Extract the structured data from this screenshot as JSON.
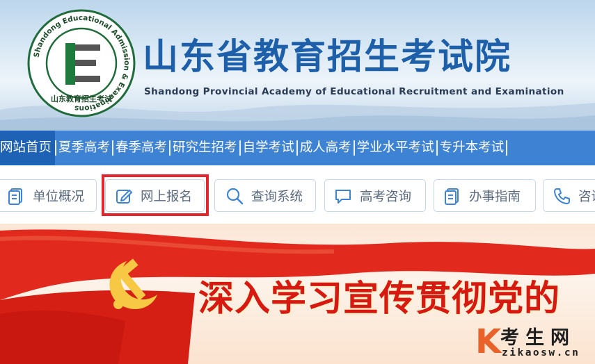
{
  "header": {
    "title": "山东省教育招生考试院",
    "subtitle": "Shandong Provincial Academy of Educational Recruitment and Examination",
    "logo": {
      "ring_text": "Shandong Educational Admission & Examinations",
      "bottom_text": "山东教育招生考试",
      "letter": "E"
    }
  },
  "nav": {
    "items": [
      {
        "label": "网站首页",
        "active": true
      },
      {
        "label": "夏季高考",
        "active": false
      },
      {
        "label": "春季高考",
        "active": false
      },
      {
        "label": "研究生招考",
        "active": false
      },
      {
        "label": "自学考试",
        "active": false
      },
      {
        "label": "成人高考",
        "active": false
      },
      {
        "label": "学业水平考试",
        "active": false
      },
      {
        "label": "专升本考试",
        "active": false
      }
    ]
  },
  "quick_links": [
    {
      "label": "单位概况",
      "icon": "document-icon"
    },
    {
      "label": "网上报名",
      "icon": "edit-icon"
    },
    {
      "label": "查询系统",
      "icon": "search-icon"
    },
    {
      "label": "高考咨询",
      "icon": "chat-icon"
    },
    {
      "label": "办事指南",
      "icon": "document-icon"
    },
    {
      "label": "咨询",
      "icon": "phone-icon"
    }
  ],
  "banner": {
    "text": "深入学习宣传贯彻党的"
  },
  "watermark": {
    "mark": "K",
    "cn": "考生网",
    "url": "zikaosw.cn"
  },
  "colors": {
    "nav_bg": "#3d82d3",
    "nav_active": "#1d62b4",
    "title_blue": "#1d5fa8",
    "highlight_red": "#e2262d",
    "banner_red": "#d61a12"
  }
}
